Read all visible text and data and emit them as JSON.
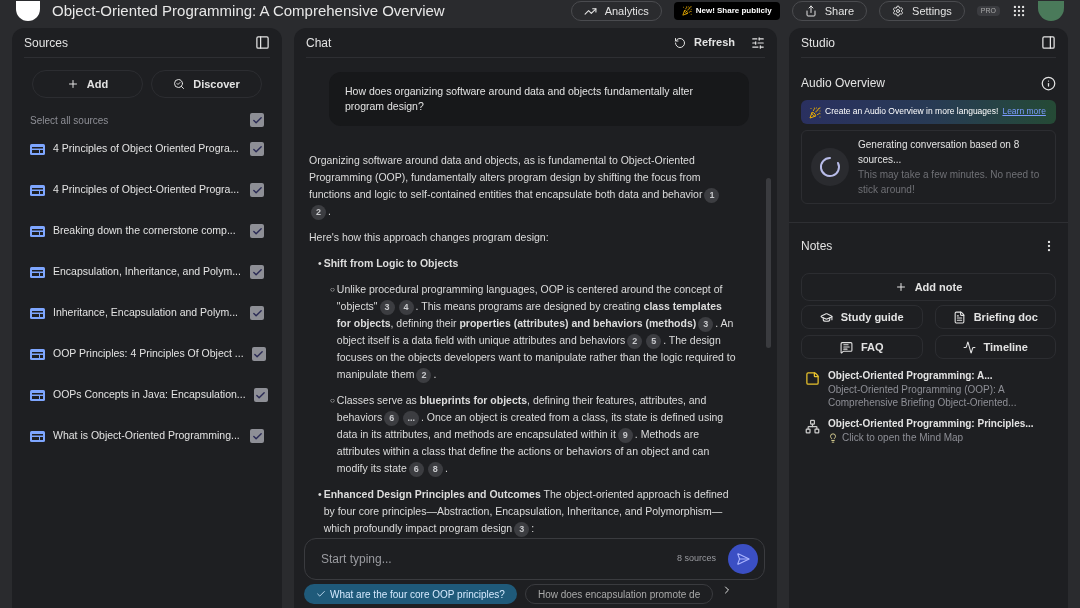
{
  "top_bar": {
    "title": "Object-Oriented Programming: A Comprehensive Overview",
    "analytics": "Analytics",
    "promo_badge": "New! Share publicly",
    "share": "Share",
    "settings": "Settings",
    "plan_badge": "PRO"
  },
  "sources": {
    "title": "Sources",
    "add": "Add",
    "discover": "Discover",
    "select_all": {
      "label": "Select all sources",
      "checked": true
    },
    "items": [
      {
        "title": "4 Principles of Object Oriented Progra...",
        "checked": true
      },
      {
        "title": "4 Principles of Object-Oriented Progra...",
        "checked": true
      },
      {
        "title": "Breaking down the cornerstone comp...",
        "checked": true
      },
      {
        "title": "Encapsulation, Inheritance, and Polym...",
        "checked": true
      },
      {
        "title": "Inheritance, Encapsulation and Polym...",
        "checked": true
      },
      {
        "title": "OOP Principles: 4 Principles Of Object ...",
        "checked": true
      },
      {
        "title": "OOPs Concepts in Java: Encapsulation...",
        "checked": true
      },
      {
        "title": "What is Object-Oriented Programming...",
        "checked": true
      }
    ]
  },
  "chat": {
    "title": "Chat",
    "refresh": "Refresh",
    "question": "How does organizing software around data and objects fundamentally alter program design?",
    "answer": [
      {
        "kind": "paragraph",
        "parts": [
          {
            "kind": "text",
            "text": "Organizing software around data and objects, as is fundamental to Object-Oriented Programming (OOP), fundamentally alters program design by shifting the focus from functions and logic to self-contained entities that encapsulate both data and behavior"
          },
          {
            "kind": "cite",
            "text": "1"
          },
          {
            "kind": "cite",
            "text": "2"
          },
          {
            "kind": "text",
            "text": "."
          }
        ]
      },
      {
        "kind": "paragraph",
        "parts": [
          {
            "kind": "text",
            "text": "Here's how this approach changes program design:"
          }
        ]
      },
      {
        "kind": "bullet",
        "marker": "•",
        "parts": [
          {
            "kind": "text",
            "text": "**Shift from Logic to Objects**"
          }
        ],
        "children": [
          {
            "marker": "○",
            "parts": [
              {
                "kind": "text",
                "text": "Unlike procedural programming languages, OOP is centered around the concept of \"objects\""
              },
              {
                "kind": "cite",
                "text": "3"
              },
              {
                "kind": "cite",
                "text": "4"
              },
              {
                "kind": "text",
                "text": ". This means programs are designed by creating **class templates for objects**, defining their **properties (attributes) and behaviors (methods)**"
              },
              {
                "kind": "cite",
                "text": "3"
              },
              {
                "kind": "text",
                "text": ". An object itself is a data field with unique attributes and behaviors"
              },
              {
                "kind": "cite",
                "text": "2"
              },
              {
                "kind": "cite",
                "text": "5"
              },
              {
                "kind": "text",
                "text": ". The design focuses on the objects developers want to manipulate rather than the logic required to manipulate them"
              },
              {
                "kind": "cite",
                "text": "2"
              },
              {
                "kind": "text",
                "text": "."
              }
            ]
          },
          {
            "marker": "○",
            "parts": [
              {
                "kind": "text",
                "text": "Classes serve as **blueprints for objects**, defining their features, attributes, and behaviors"
              },
              {
                "kind": "cite",
                "text": "6"
              },
              {
                "kind": "cite",
                "text": "..."
              },
              {
                "kind": "text",
                "text": ". Once an object is created from a class, its state is defined using data in its attributes, and methods are encapsulated within it"
              },
              {
                "kind": "cite",
                "text": "9"
              },
              {
                "kind": "text",
                "text": ". Methods are attributes within a class that define the actions or behaviors of an object and can modify its state"
              },
              {
                "kind": "cite",
                "text": "6"
              },
              {
                "kind": "cite",
                "text": "8"
              },
              {
                "kind": "text",
                "text": "."
              }
            ]
          }
        ]
      },
      {
        "kind": "bullet",
        "marker": "•",
        "parts": [
          {
            "kind": "text",
            "text": "**Enhanced Design Principles and Outcomes** The object-oriented approach is defined by four core principles—Abstraction, Encapsulation, Inheritance, and Polymorphism—which profoundly impact program design"
          },
          {
            "kind": "cite",
            "text": "3"
          },
          {
            "kind": "text",
            "text": ":"
          }
        ]
      }
    ],
    "input": {
      "placeholder": "Start typing...",
      "source_count": "8 sources"
    },
    "suggestions": [
      {
        "text": "What are the four core OOP principles?",
        "selected": true
      },
      {
        "text": "How does encapsulation promote de",
        "selected": false
      }
    ]
  },
  "studio": {
    "title": "Studio",
    "audio_title": "Audio Overview",
    "banner": {
      "text": "Create an Audio Overview in more languages!",
      "link": "Learn more"
    },
    "generating": {
      "title": "Generating conversation based on 8 sources...",
      "subtitle": "This may take a few minutes. No need to stick around!"
    },
    "notes_title": "Notes",
    "add_note": "Add note",
    "actions": [
      {
        "kind": "study",
        "label": "Study guide"
      },
      {
        "kind": "briefing",
        "label": "Briefing doc"
      },
      {
        "kind": "faq",
        "label": "FAQ"
      },
      {
        "kind": "timeline",
        "label": "Timeline"
      }
    ],
    "notes": [
      {
        "kind": "note",
        "title": "Object-Oriented Programming: A...",
        "subtitle": "Object-Oriented Programming (OOP): A Comprehensive Briefing Object-Oriented..."
      },
      {
        "kind": "mindmap",
        "title": "Object-Oriented Programming: Principles...",
        "subtitle": "Click to open the Mind Map"
      }
    ]
  }
}
